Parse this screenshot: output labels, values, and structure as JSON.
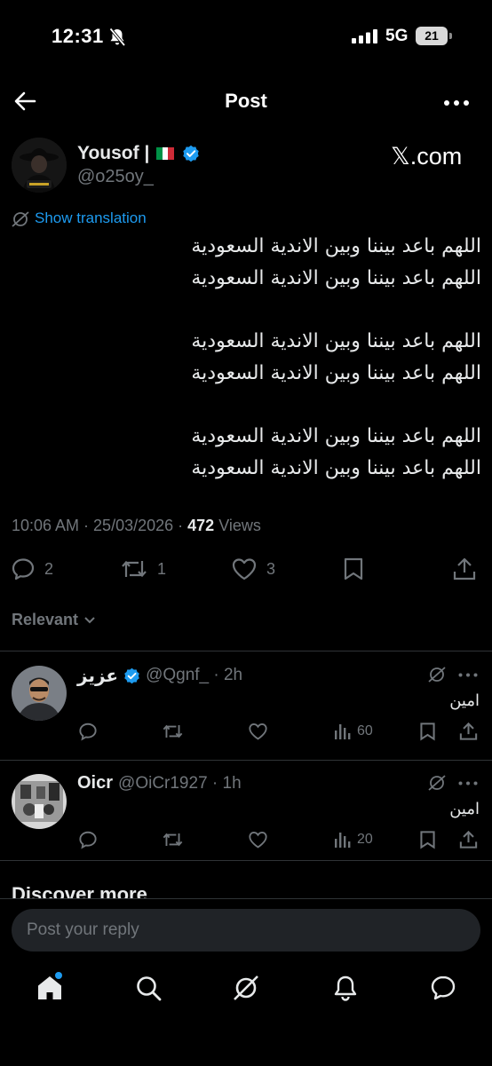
{
  "status_bar": {
    "time": "12:31",
    "network": "5G",
    "battery": "21"
  },
  "header": {
    "title": "Post"
  },
  "author": {
    "name": "Yousof |",
    "handle": "@o25oy_",
    "source": "𝕏.com",
    "flag_colors": [
      "#009246",
      "#ffffff",
      "#ce2b37"
    ],
    "verified_color": "#1d9bf0"
  },
  "translation": {
    "label": "Show translation"
  },
  "post": {
    "lines": [
      "اللهم باعد بيننا وبين الاندية السعودية",
      "اللهم باعد بيننا وبين الاندية السعودية",
      "اللهم باعد بيننا وبين الاندية السعودية",
      "اللهم باعد بيننا وبين الاندية السعودية",
      "اللهم باعد بيننا وبين الاندية السعودية",
      "اللهم باعد بيننا وبين الاندية السعودية"
    ],
    "timestamp": "10:06 AM · 25/03/2026 · ",
    "views_count": "472",
    "views_label": " Views"
  },
  "actions": {
    "replies": "2",
    "reposts": "1",
    "likes": "3"
  },
  "sort": {
    "label": "Relevant"
  },
  "replies": [
    {
      "name": "عزيز",
      "handle": "@Qgnf_ · 2h",
      "text": "امين",
      "views": "60",
      "verified": true
    },
    {
      "name": "Oicr",
      "handle": "@OiCr1927 · 1h",
      "text": "امين",
      "views": "20",
      "verified": false
    }
  ],
  "discover": {
    "label": "Discover more"
  },
  "composer": {
    "placeholder": "Post your reply"
  },
  "colors": {
    "accent": "#1d9bf0",
    "muted": "#71767b",
    "text": "#e7e9ea",
    "background": "#000000"
  }
}
